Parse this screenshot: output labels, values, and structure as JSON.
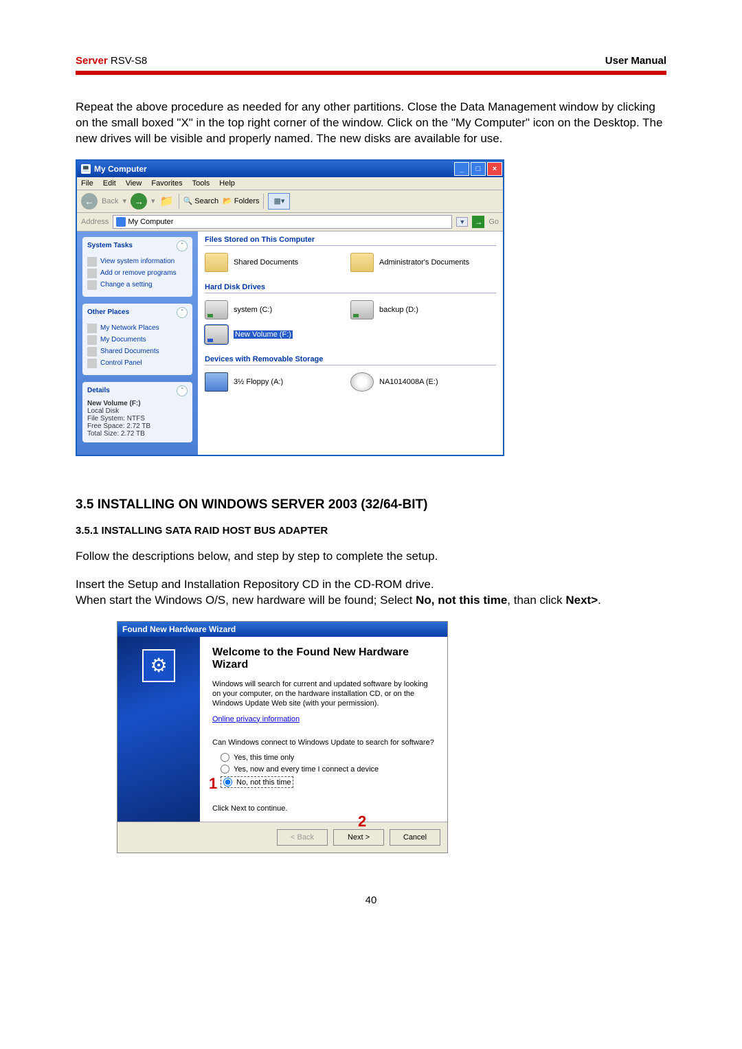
{
  "header": {
    "brand": "Server",
    "model": "RSV-S8",
    "manual": "User Manual"
  },
  "intro": "Repeat the above procedure as needed for any other partitions. Close the Data Management window by clicking on the small boxed \"X\" in the top right corner of the window. Click on the \"My Computer\" icon on the Desktop. The new drives will be visible and properly named. The new disks are available for use.",
  "explorer": {
    "title": "My Computer",
    "menu": [
      "File",
      "Edit",
      "View",
      "Favorites",
      "Tools",
      "Help"
    ],
    "toolbar": {
      "back": "Back",
      "search": "Search",
      "folders": "Folders"
    },
    "address": {
      "label": "Address",
      "value": "My Computer",
      "go": "Go"
    },
    "sidebar": {
      "panels": [
        {
          "title": "System Tasks",
          "links": [
            "View system information",
            "Add or remove programs",
            "Change a setting"
          ]
        },
        {
          "title": "Other Places",
          "links": [
            "My Network Places",
            "My Documents",
            "Shared Documents",
            "Control Panel"
          ]
        },
        {
          "title": "Details",
          "details": {
            "name": "New Volume (F:)",
            "type": "Local Disk",
            "fs": "File System: NTFS",
            "free": "Free Space: 2.72 TB",
            "total": "Total Size: 2.72 TB"
          }
        }
      ]
    },
    "groups": [
      {
        "header": "Files Stored on This Computer",
        "items": [
          {
            "label": "Shared Documents",
            "kind": "folder"
          },
          {
            "label": "Administrator's Documents",
            "kind": "folder"
          }
        ]
      },
      {
        "header": "Hard Disk Drives",
        "items": [
          {
            "label": "system (C:)",
            "kind": "drive"
          },
          {
            "label": "backup (D:)",
            "kind": "drive"
          },
          {
            "label": "New Volume (F:)",
            "kind": "drive",
            "selected": true
          }
        ]
      },
      {
        "header": "Devices with Removable Storage",
        "items": [
          {
            "label": "3½ Floppy (A:)",
            "kind": "floppy"
          },
          {
            "label": "NA1014008A (E:)",
            "kind": "cd"
          }
        ]
      }
    ]
  },
  "section": {
    "num": "3.5",
    "title": "INSTALLING ON WINDOWS SERVER 2003 (32/64-BIT)"
  },
  "subsection": {
    "num": "3.5.1",
    "title": "INSTALLING SATA RAID HOST BUS ADAPTER"
  },
  "step1": "Follow the descriptions below, and step by step to complete the setup.",
  "step2a": "Insert the Setup and Installation Repository CD in the CD-ROM drive.",
  "step2b_pre": "When start the Windows O/S, new hardware will be found; Select ",
  "step2b_bold1": "No, not this time",
  "step2b_mid": ", than click ",
  "step2b_bold2": "Next>",
  "step2b_end": ".",
  "wizard": {
    "title": "Found New Hardware Wizard",
    "heading": "Welcome to the Found New Hardware Wizard",
    "body": "Windows will search for current and updated software by looking on your computer, on the hardware installation CD, or on the Windows Update Web site (with your permission).",
    "link": "Online privacy information",
    "q": "Can Windows connect to Windows Update to search for software?",
    "opts": [
      "Yes, this time only",
      "Yes, now and every time I connect a device",
      "No, not this time"
    ],
    "cont": "Click Next to continue.",
    "btns": {
      "back": "< Back",
      "next": "Next >",
      "cancel": "Cancel"
    },
    "marks": {
      "one": "1",
      "two": "2"
    }
  },
  "pagenum": "40"
}
